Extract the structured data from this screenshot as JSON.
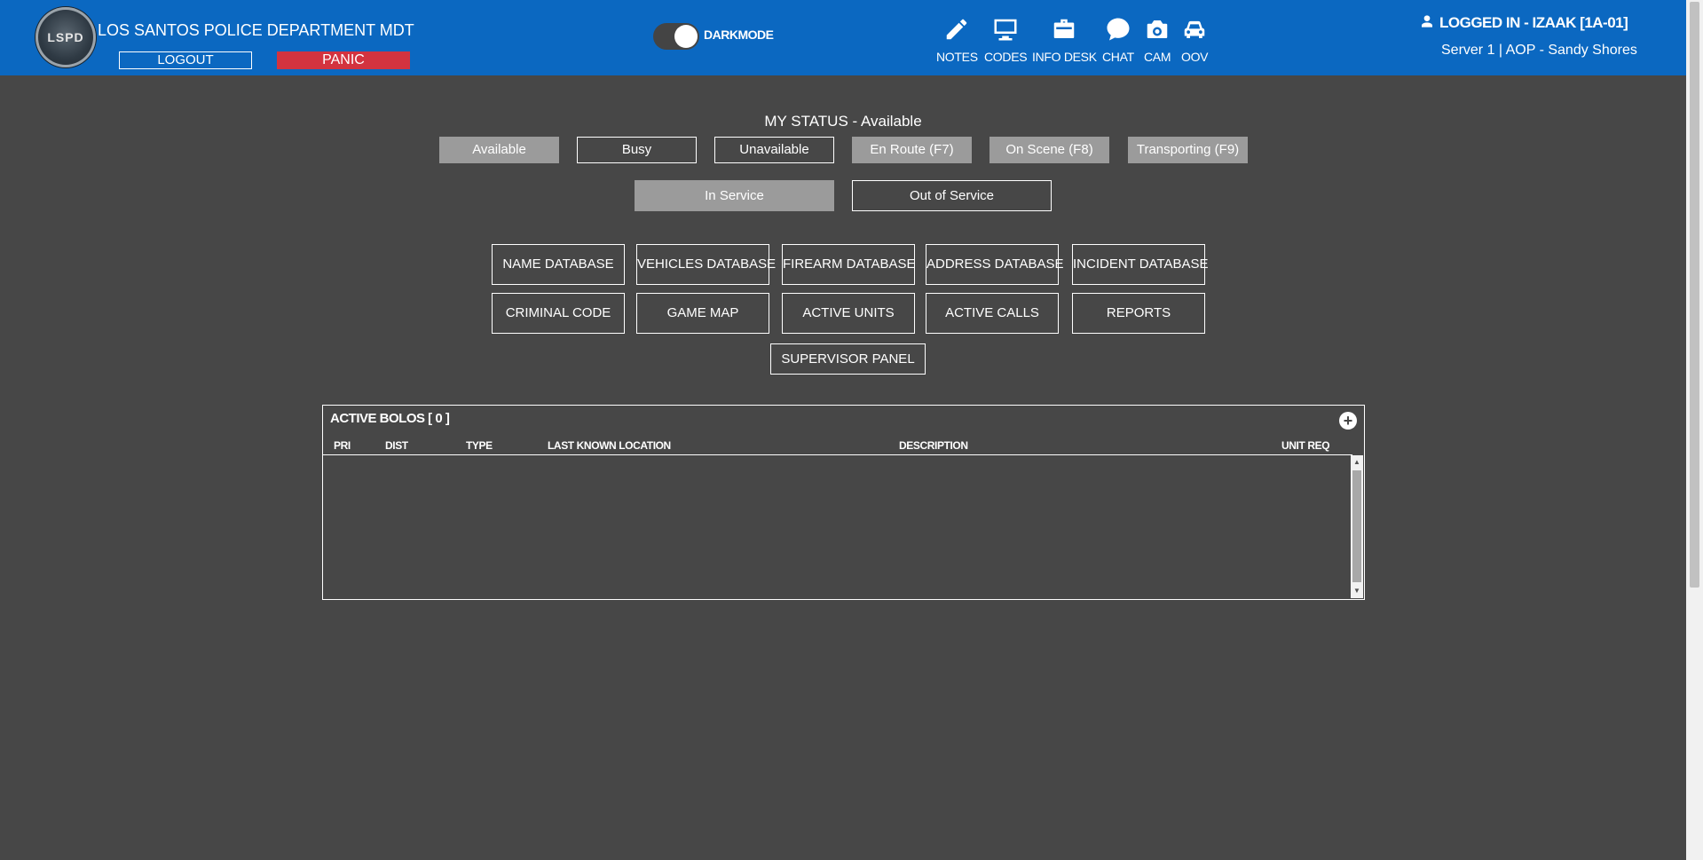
{
  "header": {
    "logo_text": "LSPD",
    "title": "LOS SANTOS POLICE DEPARTMENT MDT",
    "logout_label": "LOGOUT",
    "panic_label": "PANIC",
    "darkmode_label": "DARKMODE",
    "darkmode_on": true,
    "toolbar": [
      {
        "label": "NOTES",
        "icon": "pencil-icon"
      },
      {
        "label": "CODES",
        "icon": "monitor-icon"
      },
      {
        "label": "INFO DESK",
        "icon": "briefcase-icon"
      },
      {
        "label": "CHAT",
        "icon": "chat-bubble-icon"
      },
      {
        "label": "CAM",
        "icon": "camera-icon"
      },
      {
        "label": "OOV",
        "icon": "car-icon"
      }
    ],
    "user_text": "LOGGED IN - IZAAK [1A-01]",
    "server_text": "Server 1 | AOP - Sandy Shores"
  },
  "status": {
    "title": "MY STATUS - Available",
    "buttons": [
      "Available",
      "Busy",
      "Unavailable",
      "En Route (F7)",
      "On Scene (F8)",
      "Transporting (F9)"
    ],
    "service_buttons": [
      "In Service",
      "Out of Service"
    ]
  },
  "nav": {
    "row1": [
      "NAME DATABASE",
      "VEHICLES DATABASE",
      "FIREARM DATABASE",
      "ADDRESS DATABASE",
      "INCIDENT DATABASE"
    ],
    "row2": [
      "CRIMINAL CODE",
      "GAME MAP",
      "ACTIVE UNITS",
      "ACTIVE CALLS",
      "REPORTS"
    ],
    "supervisor": "SUPERVISOR PANEL"
  },
  "bolos": {
    "title": "ACTIVE BOLOS [ 0 ]",
    "add_label": "+",
    "columns": [
      "PRI",
      "DIST",
      "TYPE",
      "LAST KNOWN LOCATION",
      "DESCRIPTION",
      "UNIT REQ"
    ],
    "rows": []
  },
  "colors": {
    "header_bg": "#0b68c1",
    "page_bg": "#474747",
    "panic": "#d3333f",
    "active_status": "#9b9b9b"
  }
}
